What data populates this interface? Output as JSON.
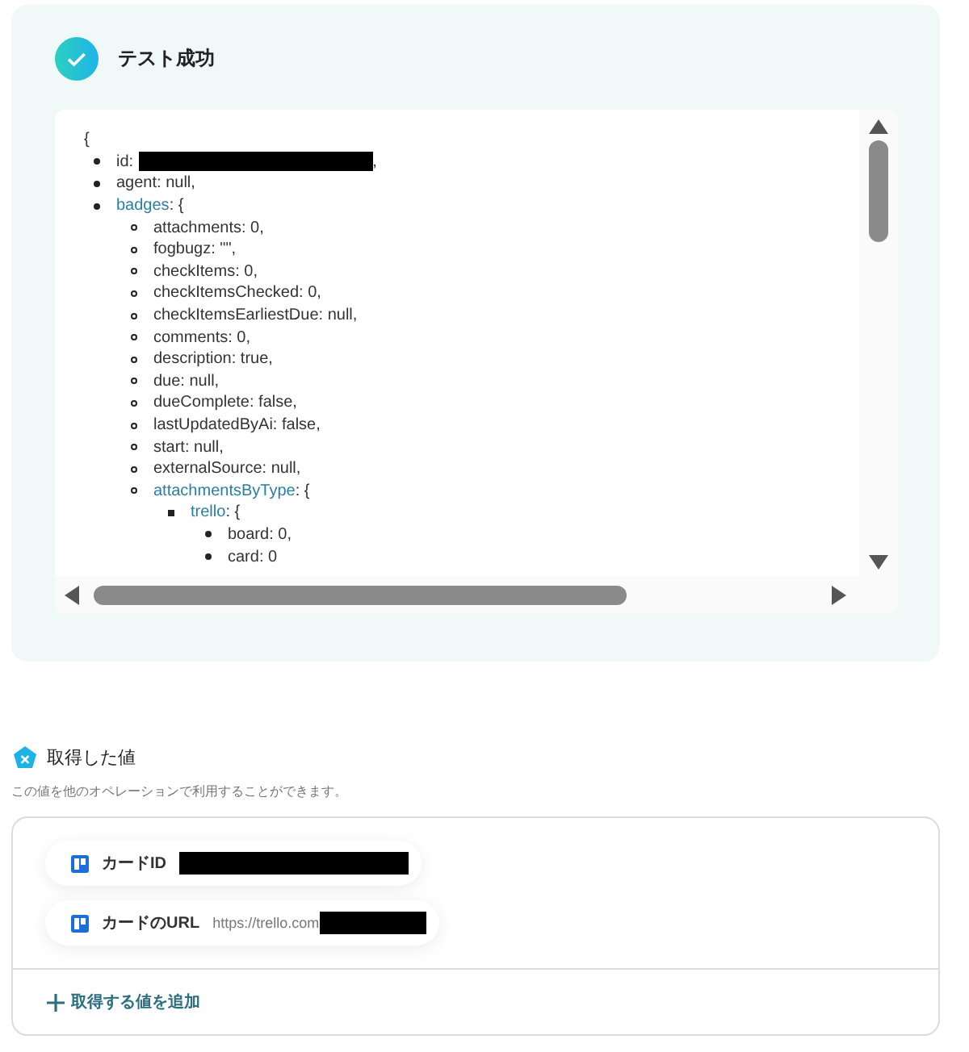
{
  "result": {
    "title": "テスト成功",
    "open_brace": "{",
    "tree": [
      {
        "kind": "leaf",
        "text": "id:",
        "redacted": true,
        "after": ","
      },
      {
        "kind": "leaf",
        "text": "agent: null,"
      },
      {
        "kind": "object",
        "key": "badges",
        "rest": ": {",
        "children": [
          {
            "kind": "leaf",
            "text": "attachments: 0,"
          },
          {
            "kind": "leaf",
            "text": "fogbugz: \"\","
          },
          {
            "kind": "leaf",
            "text": "checkItems: 0,"
          },
          {
            "kind": "leaf",
            "text": "checkItemsChecked: 0,"
          },
          {
            "kind": "leaf",
            "text": "checkItemsEarliestDue: null,"
          },
          {
            "kind": "leaf",
            "text": "comments: 0,"
          },
          {
            "kind": "leaf",
            "text": "description: true,"
          },
          {
            "kind": "leaf",
            "text": "due: null,"
          },
          {
            "kind": "leaf",
            "text": "dueComplete: false,"
          },
          {
            "kind": "leaf",
            "text": "lastUpdatedByAi: false,"
          },
          {
            "kind": "leaf",
            "text": "start: null,"
          },
          {
            "kind": "leaf",
            "text": "externalSource: null,"
          },
          {
            "kind": "object",
            "key": "attachmentsByType",
            "rest": ": {",
            "children": [
              {
                "kind": "object",
                "key": "trello",
                "rest": ": {",
                "children": [
                  {
                    "kind": "leaf",
                    "text": "board: 0,"
                  },
                  {
                    "kind": "leaf",
                    "text": "card: 0"
                  }
                ]
              }
            ]
          }
        ]
      }
    ]
  },
  "values": {
    "title": "取得した値",
    "description": "この値を他のオペレーションで利用することができます。",
    "items": [
      {
        "label": "カードID",
        "redacted": true
      },
      {
        "label": "カードのURL",
        "value": "https://trello.com",
        "redacted": true
      }
    ],
    "add_link": "取得する値を追加"
  }
}
